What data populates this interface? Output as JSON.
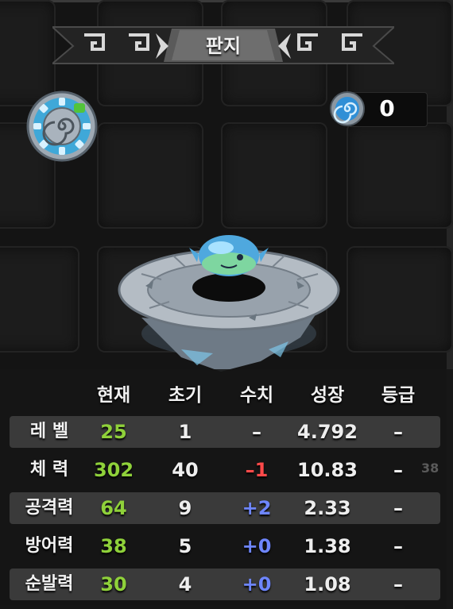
{
  "title": "판지",
  "currency": {
    "value": "0",
    "icon": "spiral-orb-icon"
  },
  "element_icon": "water-spiral-emblem-icon",
  "creature_icon": "blue-fish-creature-on-stone-pedestal",
  "stats": {
    "headers": [
      "현재",
      "초기",
      "수치",
      "성장",
      "등급"
    ],
    "rows": [
      {
        "label": "레 벨",
        "current": "25",
        "initial": "1",
        "bonus": "–",
        "bonus_color": "white",
        "growth": "4.792",
        "grade": "–"
      },
      {
        "label": "체 력",
        "current": "302",
        "initial": "40",
        "bonus": "–1",
        "bonus_color": "red",
        "growth": "10.83",
        "grade": "–"
      },
      {
        "label": "공격력",
        "current": "64",
        "initial": "9",
        "bonus": "+2",
        "bonus_color": "blue",
        "growth": "2.33",
        "grade": "–"
      },
      {
        "label": "방어력",
        "current": "38",
        "initial": "5",
        "bonus": "+0",
        "bonus_color": "blue",
        "growth": "1.38",
        "grade": "–"
      },
      {
        "label": "순발력",
        "current": "30",
        "initial": "4",
        "bonus": "+0",
        "bonus_color": "blue",
        "growth": "1.08",
        "grade": "–"
      }
    ]
  },
  "background_badge": "38",
  "colors": {
    "current": "#8fd13a",
    "negative": "#ff4a4a",
    "positive": "#6e86ff",
    "row_stripe": "#3a3a3a"
  }
}
